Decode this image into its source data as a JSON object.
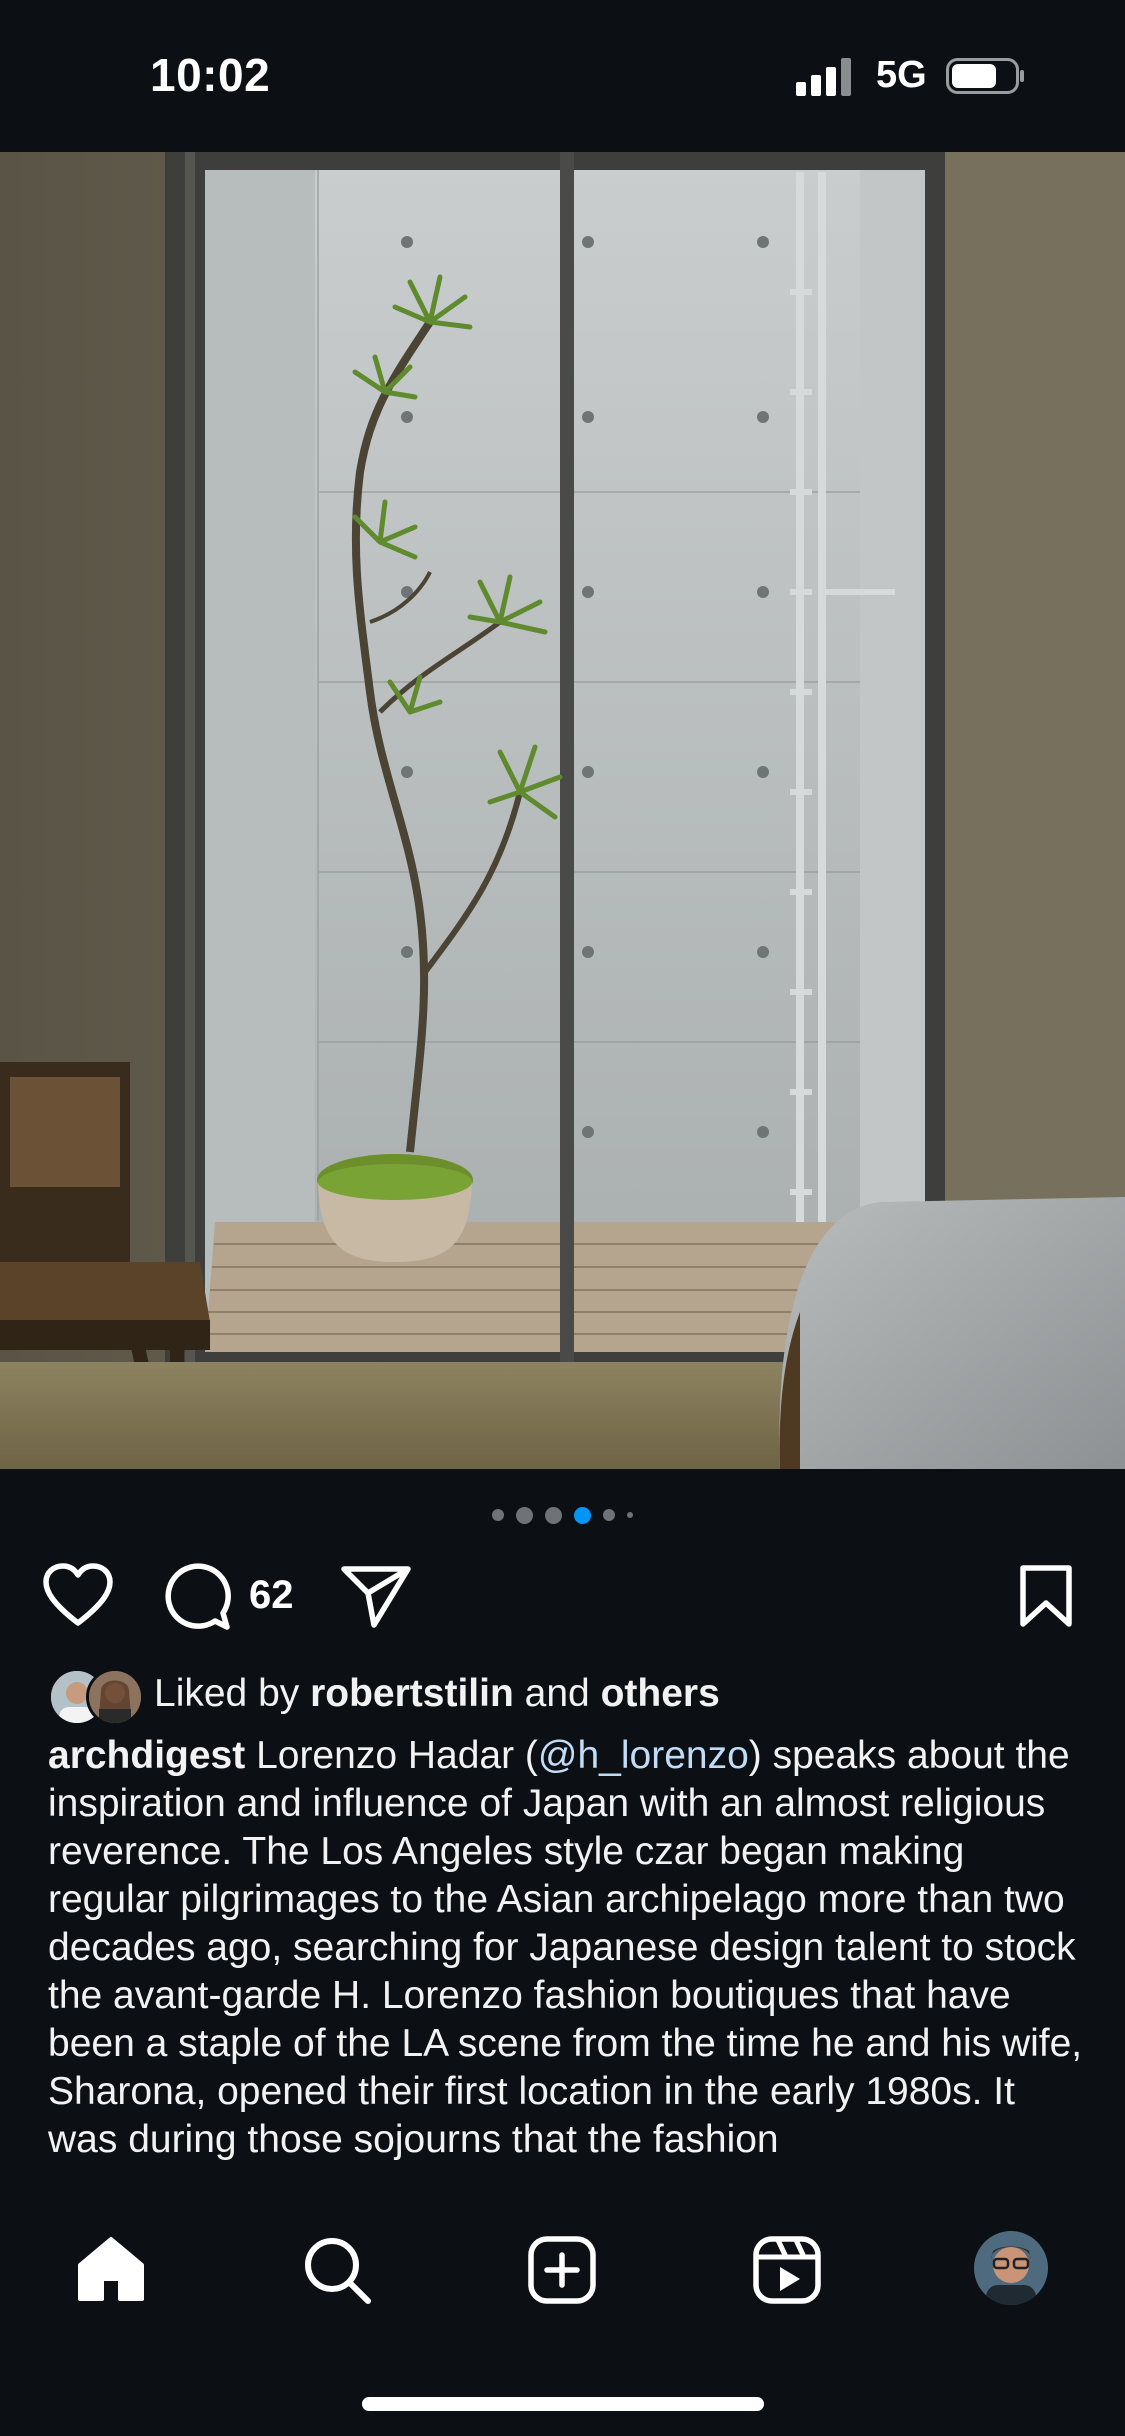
{
  "status_bar": {
    "time": "10:02",
    "network": "5G"
  },
  "post": {
    "carousel": {
      "count": 6,
      "active_index": 3
    },
    "comment_count": "62",
    "likes": {
      "prefix": "Liked by",
      "user": "robertstilin",
      "connector": "and",
      "others": "others"
    },
    "caption": {
      "username": "archdigest",
      "before_mention": " Lorenzo Hadar (",
      "mention": "@h_lorenzo",
      "after_mention": ") speaks about the inspiration and influence of Japan with an almost religious reverence. The Los Angeles style czar began making regular pilgrimages to the Asian archipelago more than two decades ago, searching for Japanese design talent to stock the avant-garde H. Lorenzo fashion boutiques that have been a staple of the LA scene from the time he and his wife, Sharona, opened their first location in the early 1980s. It was during those sojourns that the fashion"
    }
  },
  "icons": {
    "like": "heart-icon",
    "comment": "comment-icon",
    "share": "send-icon",
    "save": "bookmark-icon",
    "nav_home": "home-icon",
    "nav_search": "search-icon",
    "nav_create": "plus-square-icon",
    "nav_reels": "reels-icon",
    "nav_profile": "avatar"
  },
  "colors": {
    "background": "#0c1014",
    "accent": "#0095f6",
    "mention": "#c2dcf8"
  }
}
